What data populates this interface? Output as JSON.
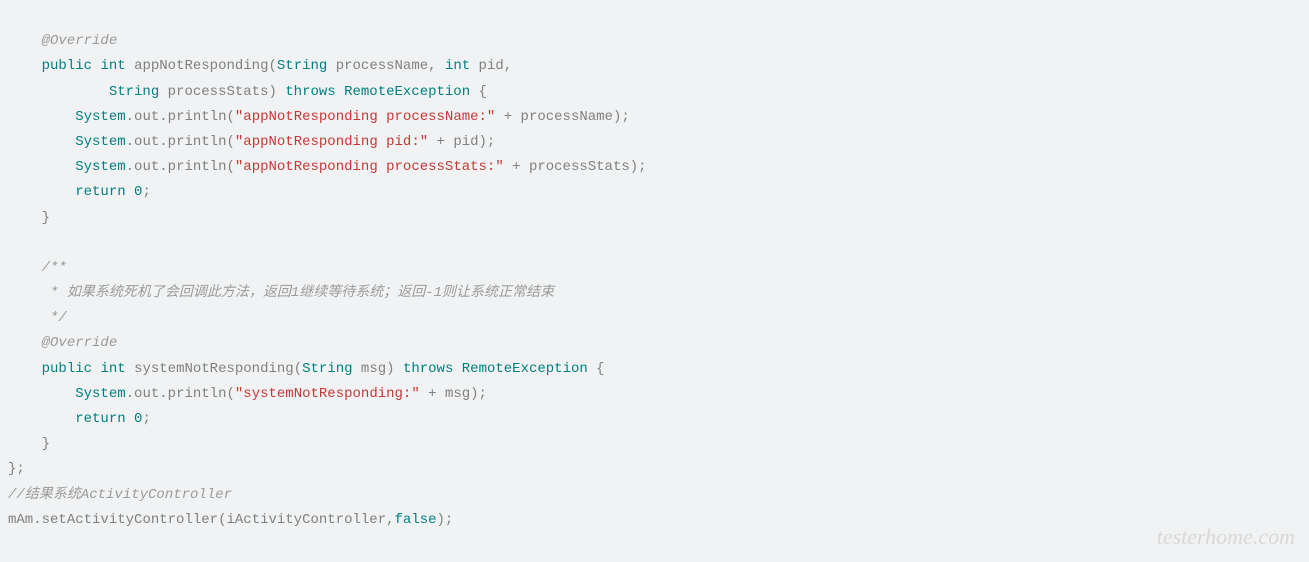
{
  "code": {
    "l1_override": "@Override",
    "l2_public": "public",
    "l2_int": "int",
    "l2_method": "appNotResponding",
    "l2_lp": "(",
    "l2_String": "String",
    "l2_p1": " processName",
    "l2_comma": ",",
    "l2_int2": " int",
    "l2_p2": " pid",
    "l2_comma2": ",",
    "l3_String": "String",
    "l3_p3": " processStats",
    "l3_rp": ")",
    "l3_throws": " throws",
    "l3_exc": " RemoteException",
    "l3_lb": " {",
    "l4_sys": "System",
    "l4_dot1": ".",
    "l4_out": "out",
    "l4_dot2": ".",
    "l4_println": "println",
    "l4_lp": "(",
    "l4_str": "\"appNotResponding processName:\"",
    "l4_plus": " + processName);",
    "l5_sys": "System",
    "l5_dot1": ".",
    "l5_out": "out",
    "l5_dot2": ".",
    "l5_println": "println",
    "l5_lp": "(",
    "l5_str": "\"appNotResponding pid:\"",
    "l5_plus": " + pid);",
    "l6_sys": "System",
    "l6_dot1": ".",
    "l6_out": "out",
    "l6_dot2": ".",
    "l6_println": "println",
    "l6_lp": "(",
    "l6_str": "\"appNotResponding processStats:\"",
    "l6_plus": " + processStats);",
    "l7_return": "return",
    "l7_zero": " 0",
    "l7_semi": ";",
    "l8_rb": "}",
    "l10_c1": "/**",
    "l11_c2": " * 如果系统死机了会回调此方法，返回1继续等待系统；返回-1则让系统正常结束",
    "l12_c3": " */",
    "l13_override": "@Override",
    "l14_public": "public",
    "l14_int": "int",
    "l14_method": "systemNotResponding",
    "l14_lp": "(",
    "l14_String": "String",
    "l14_p1": " msg",
    "l14_rp": ")",
    "l14_throws": " throws",
    "l14_exc": " RemoteException",
    "l14_lb": " {",
    "l15_sys": "System",
    "l15_dot1": ".",
    "l15_out": "out",
    "l15_dot2": ".",
    "l15_println": "println",
    "l15_lp": "(",
    "l15_str": "\"systemNotResponding:\"",
    "l15_plus": " + msg);",
    "l16_return": "return",
    "l16_zero": " 0",
    "l16_semi": ";",
    "l17_rb": "}",
    "l18_cb": "};",
    "l19_comment": "//结果系统ActivityController",
    "l20_mam": "mAm",
    "l20_dot": ".",
    "l20_method": "setActivityController",
    "l20_lp": "(",
    "l20_arg1": "iActivityController",
    "l20_comma": ",",
    "l20_false": "false",
    "l20_rp": ");"
  },
  "watermark": "testerhome.com"
}
